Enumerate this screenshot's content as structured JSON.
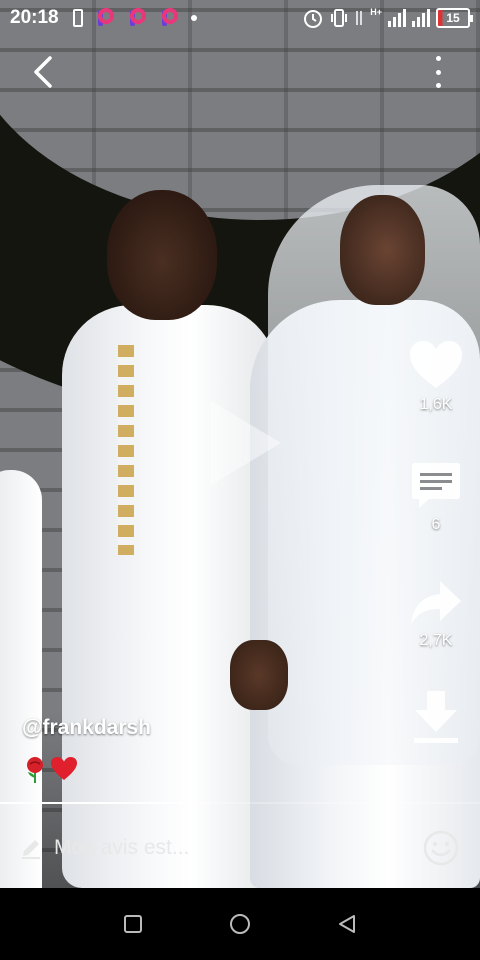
{
  "status_bar": {
    "time": "20:18",
    "battery_level": "15",
    "network": "H+"
  },
  "video": {
    "author": "@frankdarsh",
    "caption_emojis": [
      "rose-emoji",
      "red-heart-emoji"
    ],
    "progress": 0.38,
    "is_paused": true
  },
  "actions": {
    "likes": "1,6K",
    "comments": "6",
    "shares": "2,7K"
  },
  "comment_bar": {
    "placeholder": "Mon avis est..."
  },
  "colors": {
    "battery_low": "#dd3333",
    "app_icon_accent": "#e8387a",
    "app_icon_secondary": "#6b3fd6"
  }
}
